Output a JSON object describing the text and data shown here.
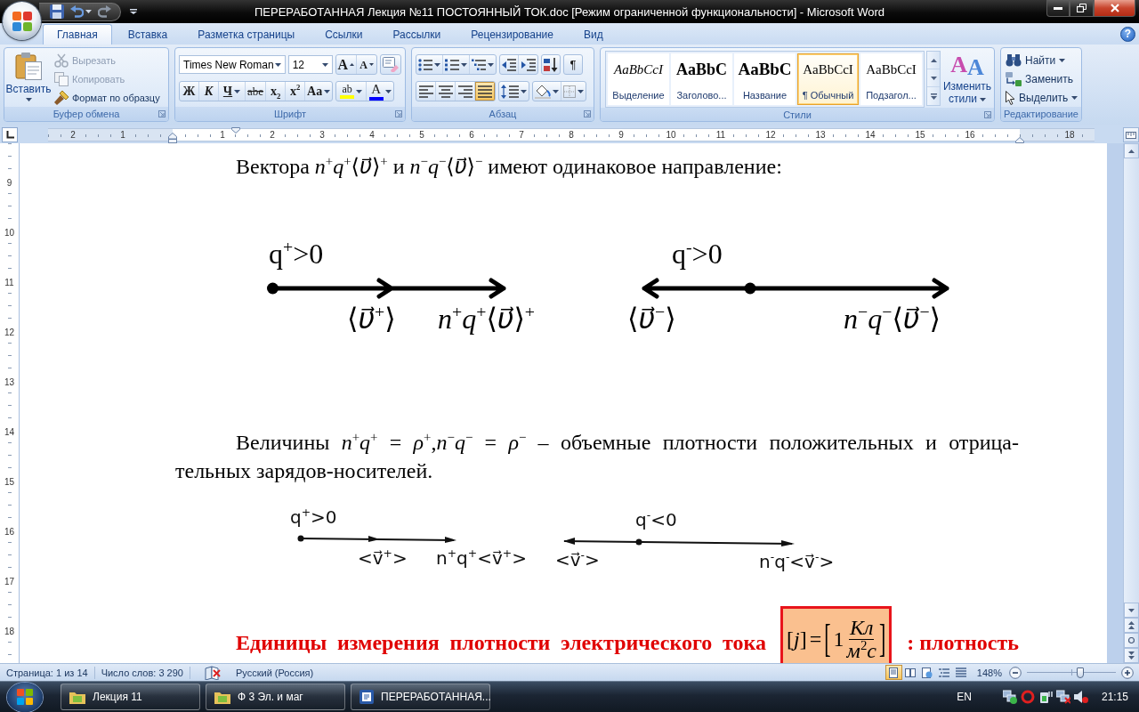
{
  "window": {
    "title": "ПЕРЕРАБОТАННАЯ Лекция №11 ПОСТОЯННЫЙ ТОК.doc [Режим ограниченной функциональности] - Microsoft Word"
  },
  "tabs": [
    {
      "label": "Главная",
      "selected": true
    },
    {
      "label": "Вставка",
      "selected": false
    },
    {
      "label": "Разметка страницы",
      "selected": false
    },
    {
      "label": "Ссылки",
      "selected": false
    },
    {
      "label": "Рассылки",
      "selected": false
    },
    {
      "label": "Рецензирование",
      "selected": false
    },
    {
      "label": "Вид",
      "selected": false
    }
  ],
  "help": "?",
  "ribbon": {
    "clipboard": {
      "title": "Буфер обмена",
      "paste": "Вставить",
      "actions": [
        {
          "kind": "cut",
          "label": "Вырезать",
          "disabled": true
        },
        {
          "kind": "copy",
          "label": "Копировать",
          "disabled": true
        },
        {
          "kind": "painter",
          "label": "Формат по образцу",
          "disabled": false
        }
      ]
    },
    "font": {
      "title": "Шрифт",
      "name": "Times New Roman",
      "size": "12",
      "size_buttons": [
        {
          "kind": "grow",
          "label": "A"
        },
        {
          "kind": "shrink",
          "label": "A"
        }
      ],
      "format_buttons": [
        {
          "kind": "bold",
          "label": "Ж",
          "menu": false
        },
        {
          "kind": "italic",
          "label": "К",
          "menu": false
        },
        {
          "kind": "underline",
          "label": "Ч",
          "menu": true
        },
        {
          "kind": "strike",
          "label": "abe",
          "menu": false
        },
        {
          "kind": "subscript",
          "label": "x$_{2}$",
          "menu": false
        },
        {
          "kind": "superscript",
          "label": "x$^{2}$",
          "menu": false
        },
        {
          "kind": "case",
          "label": "Aa",
          "menu": true
        }
      ],
      "color_buttons": [
        {
          "kind": "highlight",
          "label": "ab"
        },
        {
          "kind": "font_color",
          "label": "A"
        }
      ]
    },
    "paragraph": {
      "title": "Абзац",
      "marks": "¶",
      "align_buttons": [
        {
          "kind": "left",
          "selected": false
        },
        {
          "kind": "center",
          "selected": false
        },
        {
          "kind": "right",
          "selected": false
        },
        {
          "kind": "justify",
          "selected": true
        }
      ]
    },
    "styles": {
      "title": "Стили",
      "gallery": [
        {
          "kind": "emphasis",
          "preview": "AaBbCcI",
          "name": "Выделение",
          "selected": false
        },
        {
          "kind": "heading",
          "preview": "AaBbC",
          "name": "Заголово...",
          "selected": false
        },
        {
          "kind": "title",
          "preview": "AaBbC",
          "name": "Название",
          "selected": false
        },
        {
          "kind": "normal",
          "preview": "AaBbCcI",
          "name": "¶ Обычный",
          "selected": true
        },
        {
          "kind": "subtitle",
          "preview": "AaBbCcI",
          "name": "Подзагол...",
          "selected": false
        }
      ],
      "change": {
        "label": "Изменить стили",
        "glyphs": [
          "A",
          "A"
        ]
      }
    },
    "editing": {
      "title": "Редактирование",
      "actions": [
        {
          "kind": "find",
          "label": "Найти",
          "menu": true
        },
        {
          "kind": "replace",
          "label": "Заменить",
          "menu": false
        },
        {
          "kind": "select",
          "label": "Выделить",
          "menu": true
        }
      ]
    }
  },
  "horizontal_ruler": {
    "left_labels": [
      "2",
      "1"
    ],
    "right_labels": [
      "1",
      "2",
      "3",
      "4",
      "5",
      "6",
      "7",
      "8",
      "9",
      "10",
      "11",
      "12",
      "13",
      "14",
      "15",
      "16"
    ],
    "end_label": "18"
  },
  "vertical_ruler": {
    "labels": [
      "9",
      "10",
      "11",
      "12",
      "13",
      "14",
      "15",
      "16",
      "17",
      "18"
    ]
  },
  "document": {
    "intro": "Вектора *n*$^{+}$*q*$^{+}$⟨*υ⃗*⟩$^{+}$ и *n*$^{−}$*q*$^{−}$⟨*υ⃗*⟩$^{−}$ имеют одинаковое направление:",
    "vector_figure": {
      "positive": {
        "charge": "q$^{+}$>0",
        "velocity": "⟨*υ⃗*$^{+}$⟩",
        "product": "*n*$^{+}$*q*$^{+}$⟨*υ⃗*⟩$^{+}$"
      },
      "negative": {
        "charge": "q$^{-}$>0",
        "velocity": "⟨*υ⃗*$^{−}$⟩",
        "product": "*n*$^{−}$*q*$^{−}$⟨*υ⃗*$^{−}$⟩"
      }
    },
    "density_paragraph": "Величины *n*$^{+}$*q*$^{+}$ = *ρ*$^{+}$,*n*$^{−}$*q*$^{−}$ = *ρ*$^{−}$ – объемные плотности положительных и отрица-тельных зарядов-носителей.",
    "sketch_figure": {
      "positive": {
        "charge": "q$^{+}$>0",
        "velocity": "<v⃗$^{+}$>",
        "product": "n$^{+}$q$^{+}$<v⃗$^{+}$>"
      },
      "negative": {
        "charge": "q$^{-}$<0",
        "velocity": "<v⃗$^{-}$>",
        "product": "n$^{-}$q$^{-}$<v⃗$^{-}$>"
      }
    },
    "units_paragraph": {
      "lead": "Единицы измерения плотности электрического тока",
      "formula": {
        "lhs": "[*j*]",
        "equals": "=",
        "open": "[",
        "number": "1",
        "numerator": "*Кл*",
        "denominator": "*м*$^{2}$*с*",
        "close": "]"
      },
      "tail": ": плотность"
    }
  },
  "status_bar": {
    "page": "Страница: 1 из 14",
    "words": "Число слов: 3 290",
    "language": "Русский (Россия)",
    "views": [
      {
        "kind": "print",
        "selected": true
      },
      {
        "kind": "reading",
        "selected": false
      },
      {
        "kind": "web",
        "selected": false
      },
      {
        "kind": "outline",
        "selected": false
      },
      {
        "kind": "draft",
        "selected": false
      }
    ],
    "zoom": "148%",
    "zoom_slider": {
      "level": 0.6
    }
  },
  "taskbar": {
    "tasks": [
      {
        "kind": "folder",
        "label": "Лекция 11"
      },
      {
        "kind": "folder",
        "label": "Ф 3 Эл. и маг"
      },
      {
        "kind": "word",
        "label": "ПЕРЕРАБОТАННАЯ..."
      }
    ],
    "language": "EN",
    "clock": "21:15"
  }
}
